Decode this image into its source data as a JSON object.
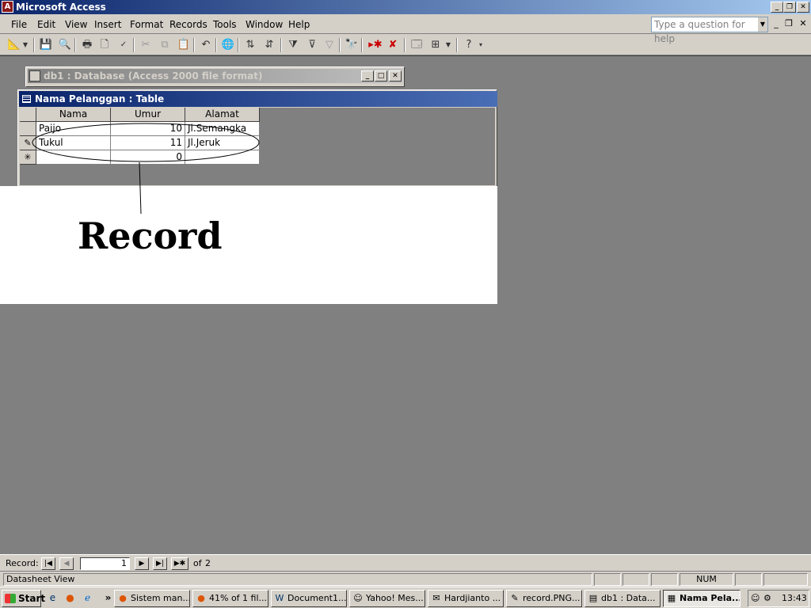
{
  "app": {
    "title": "Microsoft Access"
  },
  "menu": {
    "items": [
      "File",
      "Edit",
      "View",
      "Insert",
      "Format",
      "Records",
      "Tools",
      "Window",
      "Help"
    ],
    "help_placeholder": "Type a question for help"
  },
  "toolbar": {
    "icons": [
      "view-icon",
      "save-icon",
      "search-file-icon",
      "print-icon",
      "print-preview-icon",
      "spelling-icon",
      "cut-icon",
      "copy-icon",
      "paste-icon",
      "undo-icon",
      "hyperlink-icon",
      "sort-ascending-icon",
      "sort-descending-icon",
      "filter-by-selection-icon",
      "filter-by-form-icon",
      "apply-filter-icon",
      "find-icon",
      "new-record-icon",
      "delete-record-icon",
      "database-window-icon",
      "new-object-icon",
      "help-icon"
    ]
  },
  "db_window": {
    "title": "db1 : Database (Access 2000 file format)"
  },
  "table_window": {
    "title": "Nama Pelanggan : Table",
    "columns": [
      "Nama",
      "Umur",
      "Alamat"
    ],
    "rows": [
      {
        "selector": "",
        "nama": "Paijo",
        "umur": "10",
        "alamat": "Jl.Semangka"
      },
      {
        "selector": "✎",
        "nama": "Tukul",
        "umur": "11",
        "alamat": "Jl.Jeruk"
      },
      {
        "selector": "✳",
        "nama": "",
        "umur": "0",
        "alamat": ""
      }
    ]
  },
  "annotation": {
    "label": "Record"
  },
  "record_nav": {
    "label": "Record:",
    "current": "1",
    "of_label": "of",
    "total": "2"
  },
  "status": {
    "view": "Datasheet View",
    "num": "NUM"
  },
  "taskbar": {
    "start": "Start",
    "tasks": [
      "Sistem man...",
      "41% of 1 fil...",
      "Document1...",
      "Yahoo! Mes...",
      "Hardjianto ...",
      "record.PNG...",
      "db1 : Data...",
      "Nama Pela..."
    ],
    "clock": "13:43"
  }
}
